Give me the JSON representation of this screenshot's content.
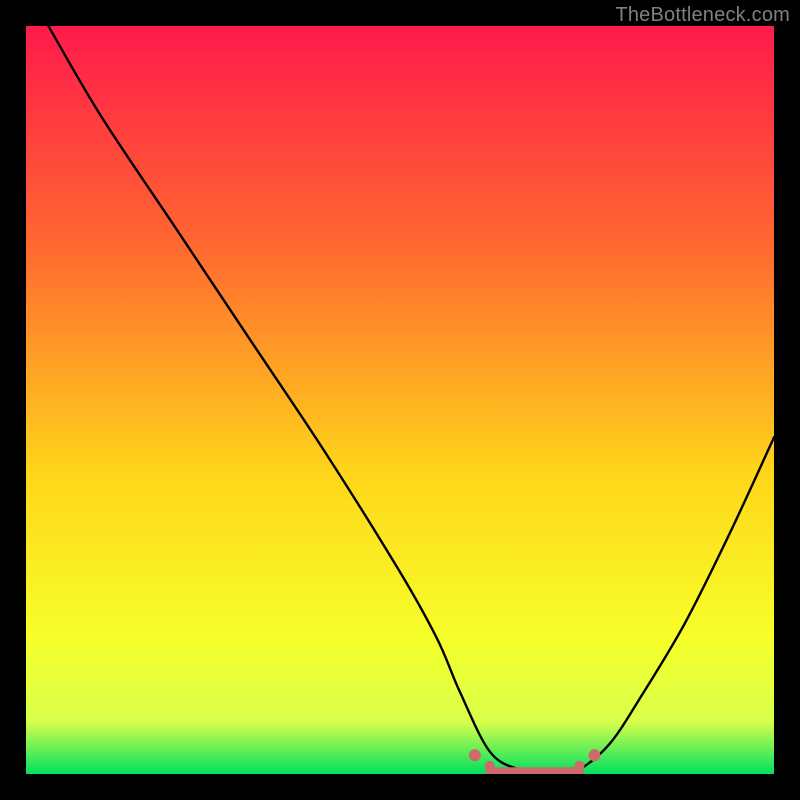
{
  "watermark": "TheBottleneck.com",
  "colors": {
    "grad_top": "#ff1a4b",
    "grad_upper_mid": "#ff6a30",
    "grad_mid": "#ffd61a",
    "grad_lower_mid": "#f6ff2a",
    "grad_near_bottom": "#d8ff4a",
    "grad_bottom": "#00e060",
    "curve": "#000000",
    "marker": "#cc6b6b",
    "frame": "#000000"
  },
  "chart_data": {
    "type": "line",
    "title": "",
    "xlabel": "",
    "ylabel": "",
    "xlim": [
      0,
      100
    ],
    "ylim": [
      0,
      100
    ],
    "x": [
      3,
      10,
      20,
      30,
      40,
      50,
      55,
      58,
      62,
      66,
      70,
      72,
      74,
      78,
      82,
      88,
      94,
      100
    ],
    "values": [
      100,
      88,
      73,
      58,
      43,
      27,
      18,
      11,
      3,
      0.6,
      0.3,
      0.3,
      0.6,
      4,
      10,
      20,
      32,
      45
    ],
    "optimal_band": {
      "x_start": 60,
      "x_end": 76,
      "y": 0.3
    },
    "markers_x": [
      60,
      62,
      64,
      66,
      68,
      70,
      72,
      73,
      74,
      76
    ]
  }
}
